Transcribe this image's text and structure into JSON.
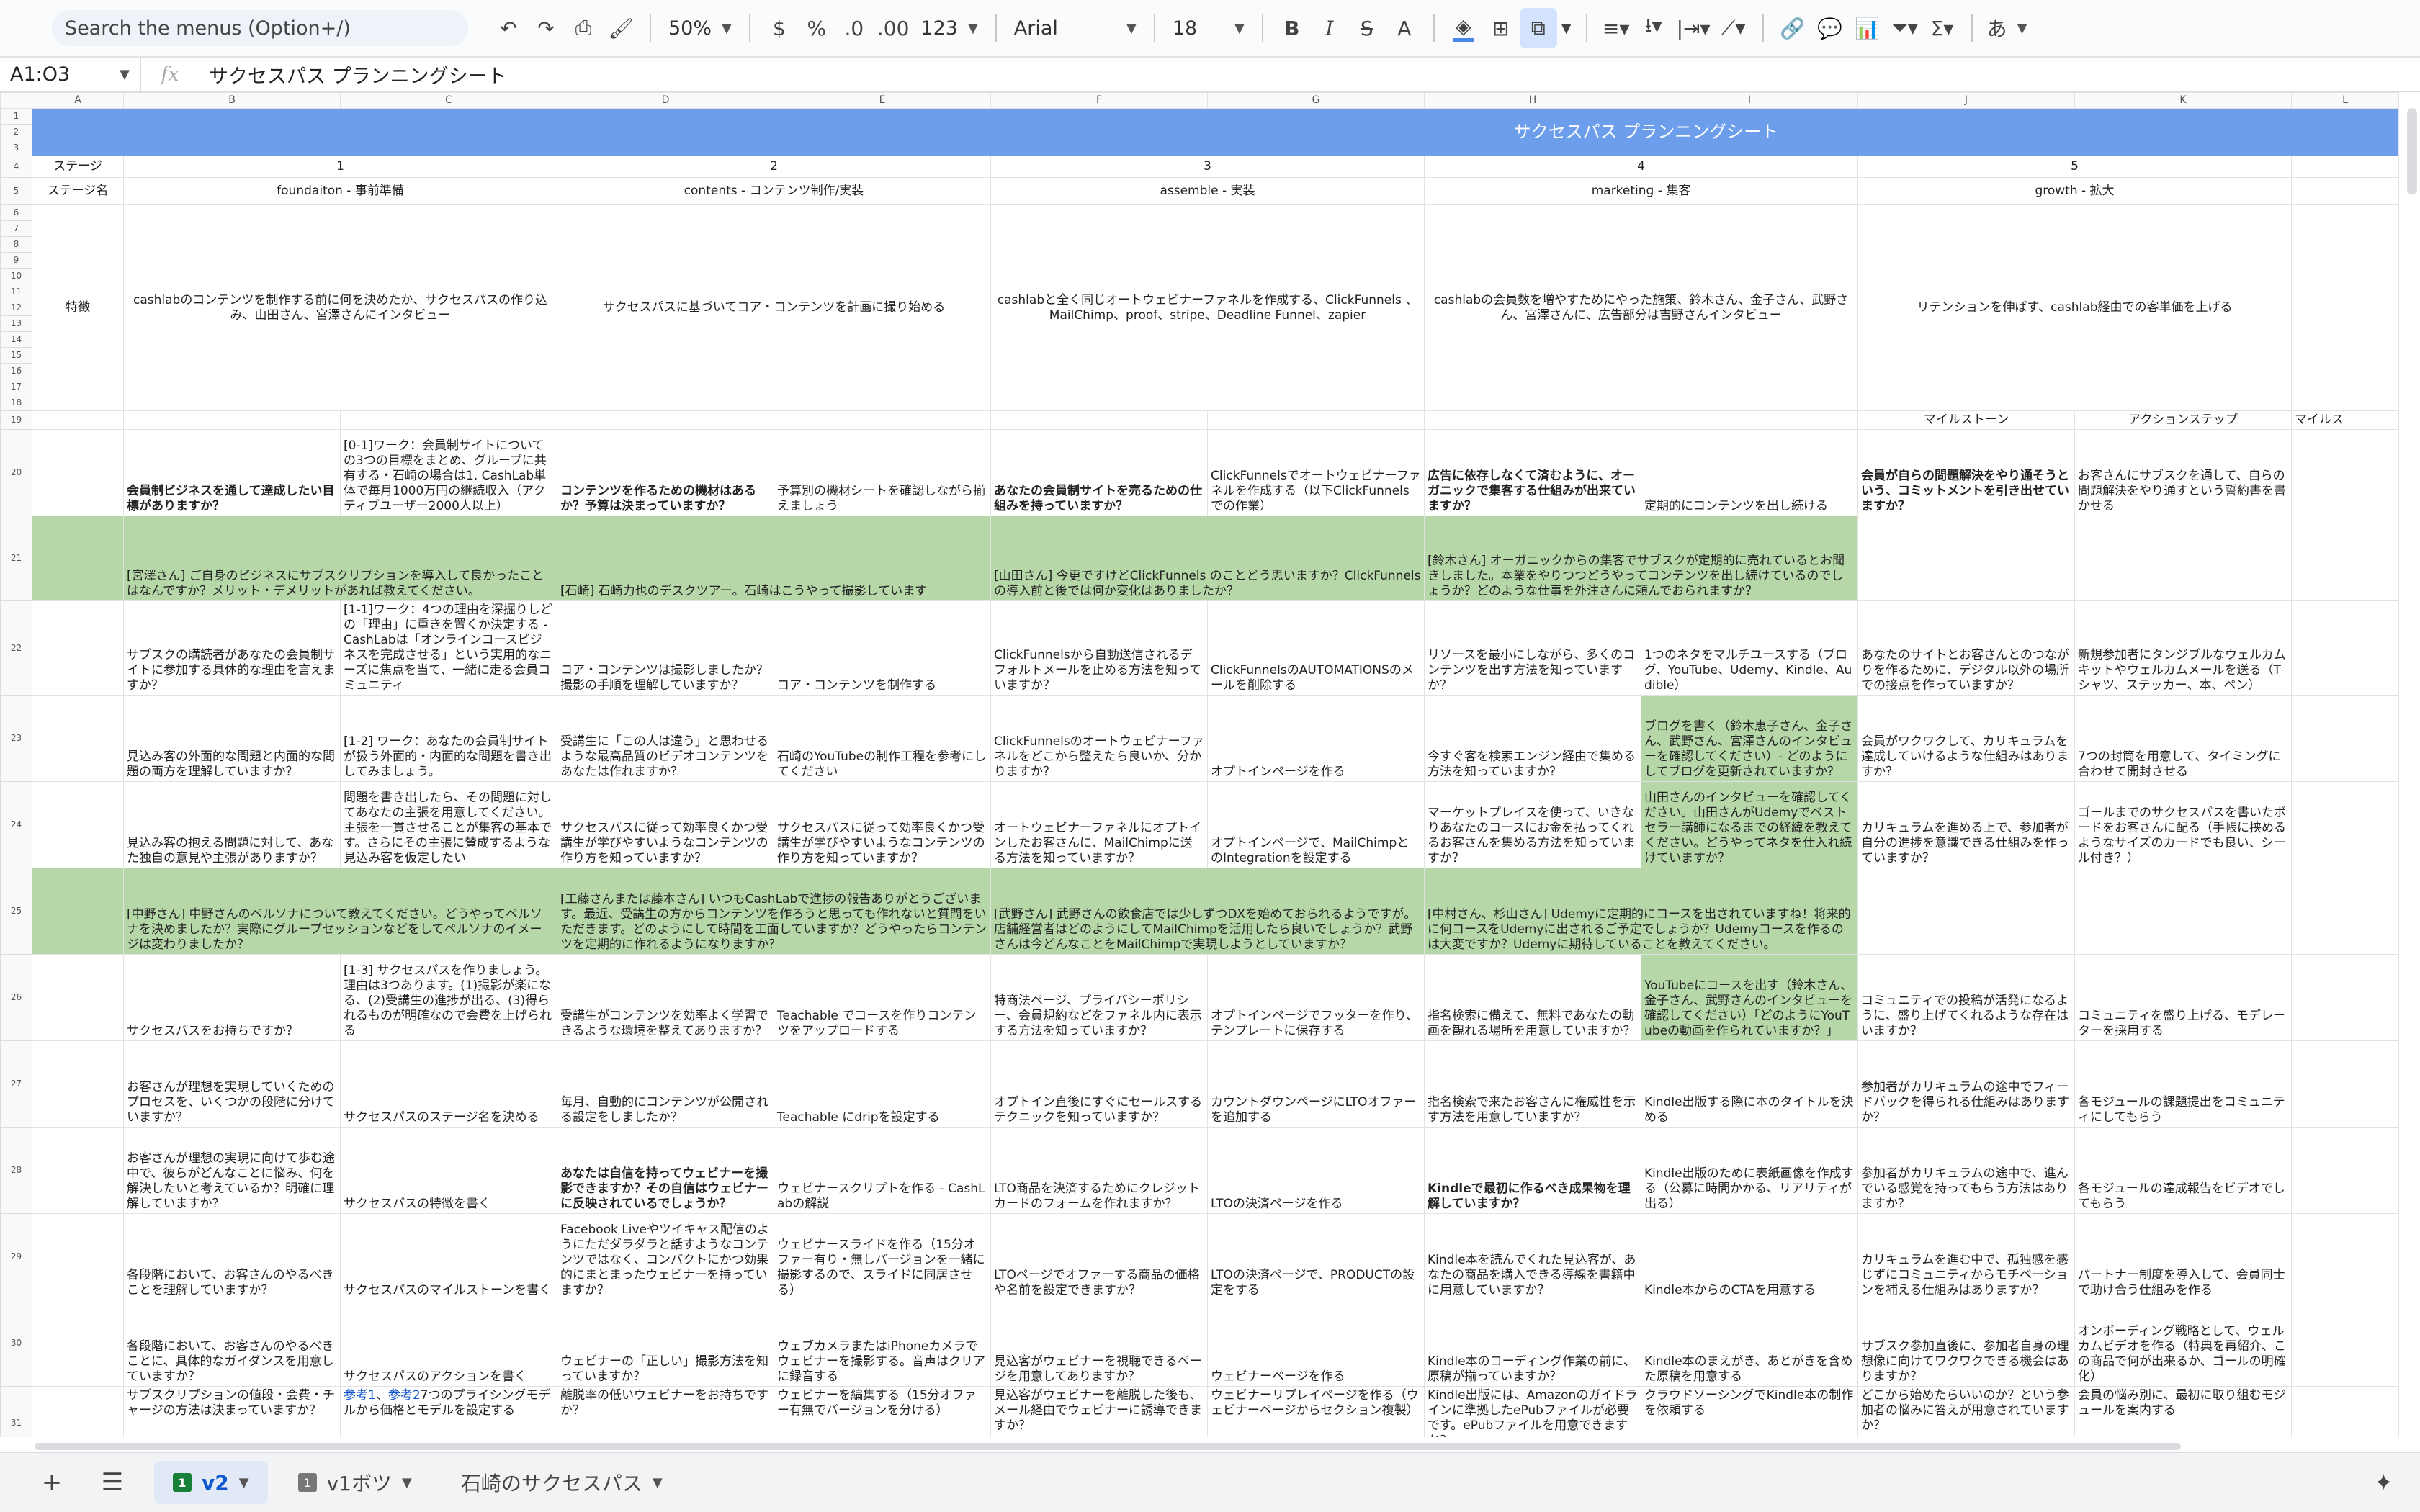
{
  "toolbar": {
    "search_placeholder": "Search the menus (Option+/)",
    "zoom": "50%",
    "currency": "$",
    "percent": "%",
    "dec_less": ".0",
    "dec_more": ".00",
    "format_more": "123",
    "font": "Arial",
    "font_size": "18",
    "bold": "B",
    "italic": "I",
    "strike": "S",
    "text_color": "A",
    "ime": "あ"
  },
  "formula": {
    "cell": "A1:O3",
    "value": "サクセスパス プランニングシート"
  },
  "columns": [
    "A",
    "B",
    "C",
    "D",
    "E",
    "F",
    "G",
    "H",
    "I",
    "J",
    "K",
    "L"
  ],
  "sheet": {
    "title": "サクセスパス プランニングシート",
    "stage_label": "ステージ",
    "stage_name_label": "ステージ名",
    "feature_label": "特徴",
    "stages": [
      "1",
      "2",
      "3",
      "4",
      "5"
    ],
    "stage_names": [
      "foundaiton - 事前準備",
      "contents - コンテンツ制作/実装",
      "assemble - 実装",
      "marketing - 集客",
      "growth - 拡大"
    ],
    "features": [
      "cashlabのコンテンツを制作する前に何を決めたか、サクセスパスの作り込み、山田さん、宮澤さんにインタビュー",
      "サクセスパスに基づいてコア・コンテンツを計画に撮り始める",
      "cashlabと全く同じオートウェビナーファネルを作成する、ClickFunnels 、MailChimp、proof、stripe、Deadline Funnel、zapier",
      "cashlabの会員数を増やすためにやった施策、鈴木さん、金子さん、武野さん、宮澤さんに、広告部分は吉野さんインタビュー",
      "リテンションを伸ばす、cashlab経由での客単価を上げる"
    ],
    "r19": {
      "milestone": "マイルストーン",
      "action": "アクションステップ",
      "milestone2": "マイルス"
    },
    "r20": [
      "会員制ビジネスを通して達成したい目標がありますか？",
      "[0-1]ワーク：会員制サイトについての3つの目標をまとめ、グループに共有する・石崎の場合は1. CashLab単体で毎月1000万円の継続収入（アクティブユーザー2000人以上）",
      "コンテンツを作るための機材はあるか？予算は決まっていますか？",
      "予算別の機材シートを確認しながら揃えましょう",
      "あなたの会員制サイトを売るための仕組みを持っていますか？",
      "ClickFunnelsでオートウェビナーファネルを作成する（以下ClickFunnels での作業）",
      "広告に依存しなくて済むように、オーガニックで集客する仕組みが出来ていますか？",
      "定期的にコンテンツを出し続ける",
      "会員が自らの問題解決をやり通そうという、コミットメントを引き出せていますか？",
      "お客さんにサブスクを通して、自らの問題解決をやり通すという誓約書を書かせる"
    ],
    "r21": [
      "[宮澤さん] ご自身のビジネスにサブスクリプションを導入して良かったことはなんですか？メリット・デメリットがあれば教えてください。",
      "[石崎] 石崎力也のデスクツアー。石崎はこうやって撮影しています",
      "[山田さん] 今更ですけどClickFunnels のことどう思いますか？ClickFunnels の導入前と後では何か変化はありましたか？",
      "[鈴木さん] オーガニックからの集客でサブスクが定期的に売れているとお聞きしました。本業をやりつつどうやってコンテンツを出し続けているのでしょうか？どのような仕事を外注さんに頼んでおられますか？"
    ],
    "r22": [
      "サブスクの購読者があなたの会員制サイトに参加する具体的な理由を言えますか？",
      "[1-1]ワーク：4つの理由を深掘りしどの「理由」に重きを置くか決定する - CashLabは「オンラインコースビジネスを完成させる」という実用的なニーズに焦点を当て、一緒に走る会員コミュニティ",
      "コア・コンテンツは撮影しましたか？撮影の手順を理解していますか？",
      "コア・コンテンツを制作する",
      "ClickFunnelsから自動送信されるデフォルトメールを止める方法を知っていますか？",
      "ClickFunnelsのAUTOMATIONSのメールを削除する",
      "リソースを最小にしながら、多くのコンテンツを出す方法を知っていますか？",
      "1つのネタをマルチユースする（ブログ、YouTube、Udemy、Kindle、Audible）",
      "あなたのサイトとお客さんとのつながりを作るために、デジタル以外の場所での接点を作っていますか？",
      "新規参加者にタンジブルなウェルカムキットやウェルカムメールを送る（Tシャツ、ステッカー、本、ペン）"
    ],
    "r23": [
      "見込み客の外面的な問題と内面的な問題の両方を理解していますか？",
      "[1-2] ワーク：あなたの会員制サイトが扱う外面的・内面的な問題を書き出してみましょう。",
      "受講生に「この人は違う」と思わせるような最高品質のビデオコンテンツをあなたは作れますか？",
      "石崎のYouTubeの制作工程を参考にしてください",
      "ClickFunnelsのオートウェビナーファネルをどこから整えたら良いか、分かりますか？",
      "オプトインページを作る",
      "今すぐ客を検索エンジン経由で集める方法を知っていますか？",
      "ブログを書く（鈴木恵子さん、金子さん、武野さん、宮澤さんのインタビューを確認してください）- どのようにしてブログを更新されていますか？",
      "会員がワクワクして、カリキュラムを達成していけるような仕組みはありますか？",
      "7つの封筒を用意して、タイミングに合わせて開封させる"
    ],
    "r24": [
      "見込み客の抱える問題に対して、あなた独自の意見や主張がありますか？",
      "問題を書き出したら、その問題に対してあなたの主張を用意してください。主張を一貫させることが集客の基本です。さらにその主張に賛成するような見込み客を仮定したい",
      "サクセスパスに従って効率良くかつ受講生が学びやすいようなコンテンツの作り方を知っていますか？",
      "サクセスパスに従って効率良くかつ受講生が学びやすいようなコンテンツの作り方を知っていますか？",
      "オートウェビナーファネルにオプトインしたお客さんに、MailChimpに送る方法を知っていますか？",
      "オプトインページで、MailChimpとのIntegrationを設定する",
      "マーケットプレイスを使って、いきなりあなたのコースにお金を払ってくれるお客さんを集める方法を知っていますか？",
      "山田さんのインタビューを確認してください。山田さんがUdemyでベストセラー講師になるまでの経緯を教えてください。どうやってネタを仕入れ続けていますか？",
      "カリキュラムを進める上で、参加者が自分の進捗を意識できる仕組みを作っていますか？",
      "ゴールまでのサクセスパスを書いたボードをお客さんに配る（手帳に挟めるようなサイズのカードでも良い、シール付き？）"
    ],
    "r25": [
      "[中野さん] 中野さんのペルソナについて教えてください。どうやってペルソナを決めましたか？実際にグループセッションなどをしてペルソナのイメージは変わりましたか？",
      "[工藤さんまたは藤本さん] いつもCashLabで進捗の報告ありがとうございます。最近、受講生の方からコンテンツを作ろうと思っても作れないと質問をいただきます。どのようにして時間を工面していますか？どうやったらコンテンツを定期的に作れるようになりますか？",
      "[武野さん] 武野さんの飲食店では少しずつDXを始めておられるようですが。店舗経営者はどのようにしてMailChimpを活用したら良いでしょうか？武野さんは今どんなことをMailChimpで実現しようとしていますか？",
      "[中村さん、杉山さん] Udemyに定期的にコースを出されていますね！将来的に何コースをUdemyに出されるご予定でしょうか？Udemyコースを作るのは大変ですか？Udemyに期待していることを教えてください。"
    ],
    "r26": [
      "サクセスパスをお持ちですか？",
      "[1-3] サクセスパスを作りましょう。理由は3つあります。(1)撮影が楽になる、(2)受講生の進捗が出る、(3)得られるものが明確なので会費を上げられる",
      "受講生がコンテンツを効率よく学習できるような環境を整えてありますか？",
      "Teachable でコースを作りコンテンツをアップロードする",
      "特商法ページ、プライバシーポリシー、会員規約などをファネル内に表示する方法を知っていますか？",
      "オプトインページでフッターを作り、テンプレートに保存する",
      "指名検索に備えて、無料であなたの動画を観れる場所を用意していますか？",
      "YouTubeにコースを出す（鈴木さん、金子さん、武野さんのインタビューを確認してください）「どのようにYouTubeの動画を作られていますか？」",
      "コミュニティでの投稿が活発になるように、盛り上げてくれるような存在はいますか？",
      "コミュニティを盛り上げる、モデレーターを採用する"
    ],
    "r27": [
      "お客さんが理想を実現していくためのプロセスを、いくつかの段階に分けていますか？",
      "サクセスパスのステージ名を決める",
      "毎月、自動的にコンテンツが公開される設定をしましたか？",
      "Teachable にdripを設定する",
      "オプトイン直後にすぐにセールスするテクニックを知っていますか？",
      "カウントダウンページにLTOオファーを追加する",
      "指名検索で来たお客さんに権威性を示す方法を用意していますか？",
      "Kindle出版する際に本のタイトルを決める",
      "参加者がカリキュラムの途中でフィードバックを得られる仕組みはありますか？",
      "各モジュールの課題提出をコミュニティにしてもらう"
    ],
    "r28": [
      "お客さんが理想の実現に向けて歩む途中で、彼らがどんなことに悩み、何を解決したいと考えているか？明確に理解していますか？",
      "サクセスパスの特徴を書く",
      "あなたは自信を持ってウェビナーを撮影できますか？その自信はウェビナーに反映されているでしょうか？",
      "ウェビナースクリプトを作る - CashLabの解説",
      "LTO商品を決済するためにクレジットカードのフォームを作れますか？",
      "LTOの決済ページを作る",
      "Kindleで最初に作るべき成果物を理解していますか？",
      "Kindle出版のために表紙画像を作成する（公募に時間かかる、リアリティが出る）",
      "参加者がカリキュラムの途中で、進んでいる感覚を持ってもらう方法はありますか？",
      "各モジュールの達成報告をビデオでしてもらう"
    ],
    "r29": [
      "各段階において、お客さんのやるべきことを理解していますか？",
      "サクセスパスのマイルストーンを書く",
      "Facebook Liveやツイキャス配信のようにただダラダラと話すようなコンテンツではなく、コンパクトにかつ効果的にまとまったウェビナーを持っていますか？",
      "ウェビナースライドを作る（15分オファー有り・無しバージョンを一緒に撮影するので、スライドに同居させる）",
      "LTOページでオファーする商品の価格や名前を設定できますか？",
      "LTOの決済ページで、PRODUCTの設定をする",
      "Kindle本を読んでくれた見込客が、あなたの商品を購入できる導線を書籍中に用意していますか？",
      "Kindle本からのCTAを用意する",
      "カリキュラムを進む中で、孤独感を感じずにコミュニティからモチベーションを補える仕組みはありますか？",
      "パートナー制度を導入して、会員同士で助け合う仕組みを作る"
    ],
    "r30": [
      "各段階において、お客さんのやるべきことに、具体的なガイダンスを用意していますか？",
      "サクセスパスのアクションを書く",
      "ウェビナーの「正しい」撮影方法を知っていますか？",
      "ウェブカメラまたはiPhoneカメラでウェビナーを撮影する。音声はクリアに録音する",
      "見込客がウェビナーを視聴できるページを用意してありますか？",
      "ウェビナーページを作る",
      "Kindle本のコーディング作業の前に、原稿が揃っていますか？",
      "Kindle本のまえがき、あとがきを含めた原稿を用意する",
      "サブスク参加直後に、参加者自身の理想像に向けてワクワクできる機会はありますか？",
      "オンボーディング戦略として、ウェルカムビデオを作る（特典を再紹介、この商品で何が出来るか、ゴールの明確化）"
    ],
    "r31": [
      "サブスクリプションの値段・会費・チャージの方法は決まっていますか？",
      "参考1",
      "参考2",
      "7つのプライシングモデルから価格とモデルを設定する",
      "離脱率の低いウェビナーをお持ちですか？",
      "ウェビナーを編集する（15分オファー有無でバージョンを分ける）",
      "見込客がウェビナーを離脱した後も、メール経由でウェビナーに誘導できますか？",
      "ウェビナーリプレイページを作る（ウェビナーページからセクション複製）",
      "Kindle出版には、Amazonのガイドラインに準拠したePubファイルが必要です。ePubファイルを用意できますか？",
      "クラウドソーシングでKindle本の制作を依頼する",
      "どこから始めたらいいのか？という参加者の悩みに答えが用意されていますか？",
      "会員の悩み別に、最初に取り組むモジュールを案内する"
    ]
  },
  "tabs": [
    {
      "num": "1",
      "label": "v2"
    },
    {
      "num": "1",
      "label": "v1ボツ"
    },
    {
      "label": "石崎のサクセスパス"
    }
  ]
}
